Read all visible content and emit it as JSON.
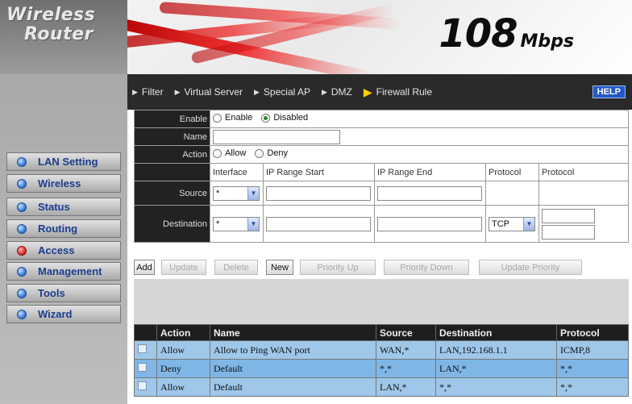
{
  "brand": {
    "line1": "Wireless",
    "line2": "Router"
  },
  "banner": {
    "speed_number": "108",
    "speed_unit": "Mbps"
  },
  "tabs": [
    {
      "label": "Filter",
      "active": false
    },
    {
      "label": "Virtual Server",
      "active": false
    },
    {
      "label": "Special AP",
      "active": false
    },
    {
      "label": "DMZ",
      "active": false
    },
    {
      "label": "Firewall Rule",
      "active": true
    }
  ],
  "help_label": "HELP",
  "sidebar": {
    "items": [
      {
        "label": "LAN Setting",
        "active": false
      },
      {
        "label": "Wireless",
        "active": false
      },
      {
        "label": "Status",
        "active": false
      },
      {
        "label": "Routing",
        "active": false
      },
      {
        "label": "Access",
        "active": true
      },
      {
        "label": "Management",
        "active": false
      },
      {
        "label": "Tools",
        "active": false
      },
      {
        "label": "Wizard",
        "active": false
      }
    ]
  },
  "form": {
    "enable_label": "Enable",
    "enable_opt": "Enable",
    "disable_opt": "Disabled",
    "enable_selected": "Disabled",
    "name_label": "Name",
    "name_value": "",
    "action_label": "Action",
    "allow_opt": "Allow",
    "deny_opt": "Deny",
    "col_interface": "Interface",
    "col_ip_start": "IP Range Start",
    "col_ip_end": "IP Range End",
    "col_protocol1": "Protocol",
    "col_protocol2": "Protocol",
    "source_label": "Source",
    "source_iface": "*",
    "destination_label": "Destination",
    "dest_iface": "*",
    "dest_protocol": "TCP",
    "port_dash": "-"
  },
  "buttons": {
    "add": "Add",
    "update": "Update",
    "delete": "Delete",
    "new": "New",
    "priority_up": "Priority Up",
    "priority_down": "Priority Down",
    "update_priority": "Update Priority"
  },
  "rules": {
    "headers": [
      "",
      "Action",
      "Name",
      "Source",
      "Destination",
      "Protocol"
    ],
    "rows": [
      {
        "action": "Allow",
        "name": "Allow to Ping WAN port",
        "source": "WAN,*",
        "destination": "LAN,192.168.1.1",
        "protocol": "ICMP,8"
      },
      {
        "action": "Deny",
        "name": "Default",
        "source": "*,*",
        "destination": "LAN,*",
        "protocol": "*,*"
      },
      {
        "action": "Allow",
        "name": "Default",
        "source": "LAN,*",
        "destination": "*,*",
        "protocol": "*,*"
      }
    ]
  },
  "colors": {
    "tabbar_bg": "#2a2a2a",
    "row_even": "#9ec7ea",
    "row_odd": "#7fb6e6",
    "nav_text": "#1b3c8e",
    "active_dot": "#d02020"
  }
}
